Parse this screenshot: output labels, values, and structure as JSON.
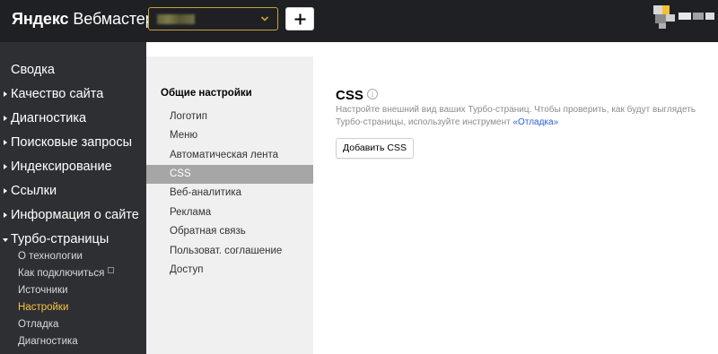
{
  "header": {
    "logo_brand": "Яндекс",
    "logo_product": "Вебмастер",
    "add_label": "+"
  },
  "sidebar": {
    "items": [
      {
        "label": "Сводка",
        "arrow": "none"
      },
      {
        "label": "Качество сайта",
        "arrow": "right"
      },
      {
        "label": "Диагностика",
        "arrow": "right"
      },
      {
        "label": "Поисковые запросы",
        "arrow": "right"
      },
      {
        "label": "Индексирование",
        "arrow": "right"
      },
      {
        "label": "Ссылки",
        "arrow": "right"
      },
      {
        "label": "Информация о сайте",
        "arrow": "right"
      },
      {
        "label": "Турбо-страницы",
        "arrow": "down"
      }
    ],
    "sub_items": [
      {
        "label": "О технологии",
        "active": false
      },
      {
        "label": "Как подключиться",
        "active": false,
        "external_icon": "external-link-icon"
      },
      {
        "label": "Источники",
        "active": false
      },
      {
        "label": "Настройки",
        "active": true
      },
      {
        "label": "Отладка",
        "active": false
      },
      {
        "label": "Диагностика",
        "active": false
      }
    ]
  },
  "settings_panel": {
    "title": "Общие настройки",
    "items": [
      {
        "label": "Логотип",
        "active": false
      },
      {
        "label": "Меню",
        "active": false
      },
      {
        "label": "Автоматическая лента",
        "active": false
      },
      {
        "label": "CSS",
        "active": true
      },
      {
        "label": "Веб-аналитика",
        "active": false
      },
      {
        "label": "Реклама",
        "active": false
      },
      {
        "label": "Обратная связь",
        "active": false
      },
      {
        "label": "Пользоват. соглашение",
        "active": false
      },
      {
        "label": "Доступ",
        "active": false
      }
    ]
  },
  "content": {
    "title": "CSS",
    "info_icon": "info-icon",
    "desc_line1": "Настройте внешний вид ваших Турбо-страниц. Чтобы проверить, как будут выглядеть",
    "desc_line2": "Турбо-страницы, используйте инструмент",
    "desc_link": "«Отладка»",
    "button_label": "Добавить CSS"
  },
  "colors": {
    "header_bg": "#1f2024",
    "sidebar_bg": "#2e2f33",
    "panel_bg": "#f0f0f0",
    "active_sub": "#f6c343",
    "active_panel_item": "#a6a6a6",
    "link": "#2a5bd7",
    "select_border": "#c8a23a"
  }
}
